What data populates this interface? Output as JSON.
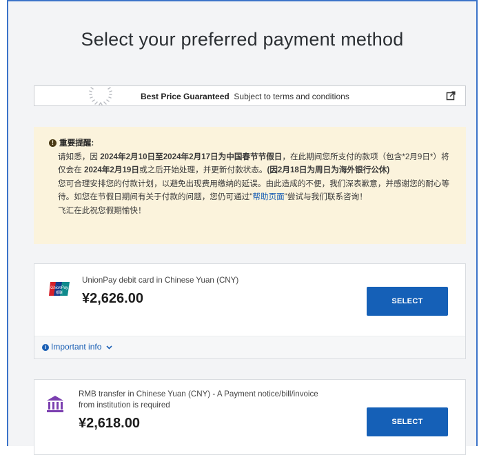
{
  "page_title": "Select your preferred payment method",
  "banner": {
    "bold": "Best Price Guaranteed",
    "text": "Subject to terms and conditions",
    "icon": "external-link-icon"
  },
  "notice": {
    "icon": "info-icon",
    "heading": "重要提醒:",
    "p1_a": "请知悉，因",
    "p1_b": "2024年2月10日至",
    "p1_c": "2024年2月17日为中国春节节假日",
    "p1_d": "，在此期间您所支付的款项（包含*2月9日*）将仅会在",
    "p1_e": "2024年2月19日",
    "p1_f": "或之后开始处理，并更新付款状态。",
    "p1_g": "(因2月18日为周日为海外银行公休)",
    "p2_a": "您可合理安排您的付款计划，以避免出现费用缴纳的延误。由此造成的不便，我们深表歉意，并感谢您的耐心等待。如您在节假日期间有关于付款的问题，您仍可通过\"",
    "p2_link": "帮助页面",
    "p2_b": "\"尝试与我们联系咨询！",
    "p3": "飞汇在此祝您假期愉快！"
  },
  "options": [
    {
      "icon": "unionpay-icon",
      "description": "UnionPay debit card in Chinese Yuan (CNY)",
      "price": "¥2,626.00",
      "button": "SELECT",
      "info_label": "Important info",
      "info_icon": "info-icon"
    },
    {
      "icon": "bank-icon",
      "description_line1": "RMB transfer in Chinese Yuan (CNY) - A Payment notice/bill/invoice",
      "description_line2": "from institution is required",
      "price": "¥2,618.00",
      "button": "SELECT"
    }
  ],
  "colors": {
    "accent": "#1560b7",
    "notice_bg": "#fbf3dc",
    "frame_border": "#3b73c9"
  }
}
